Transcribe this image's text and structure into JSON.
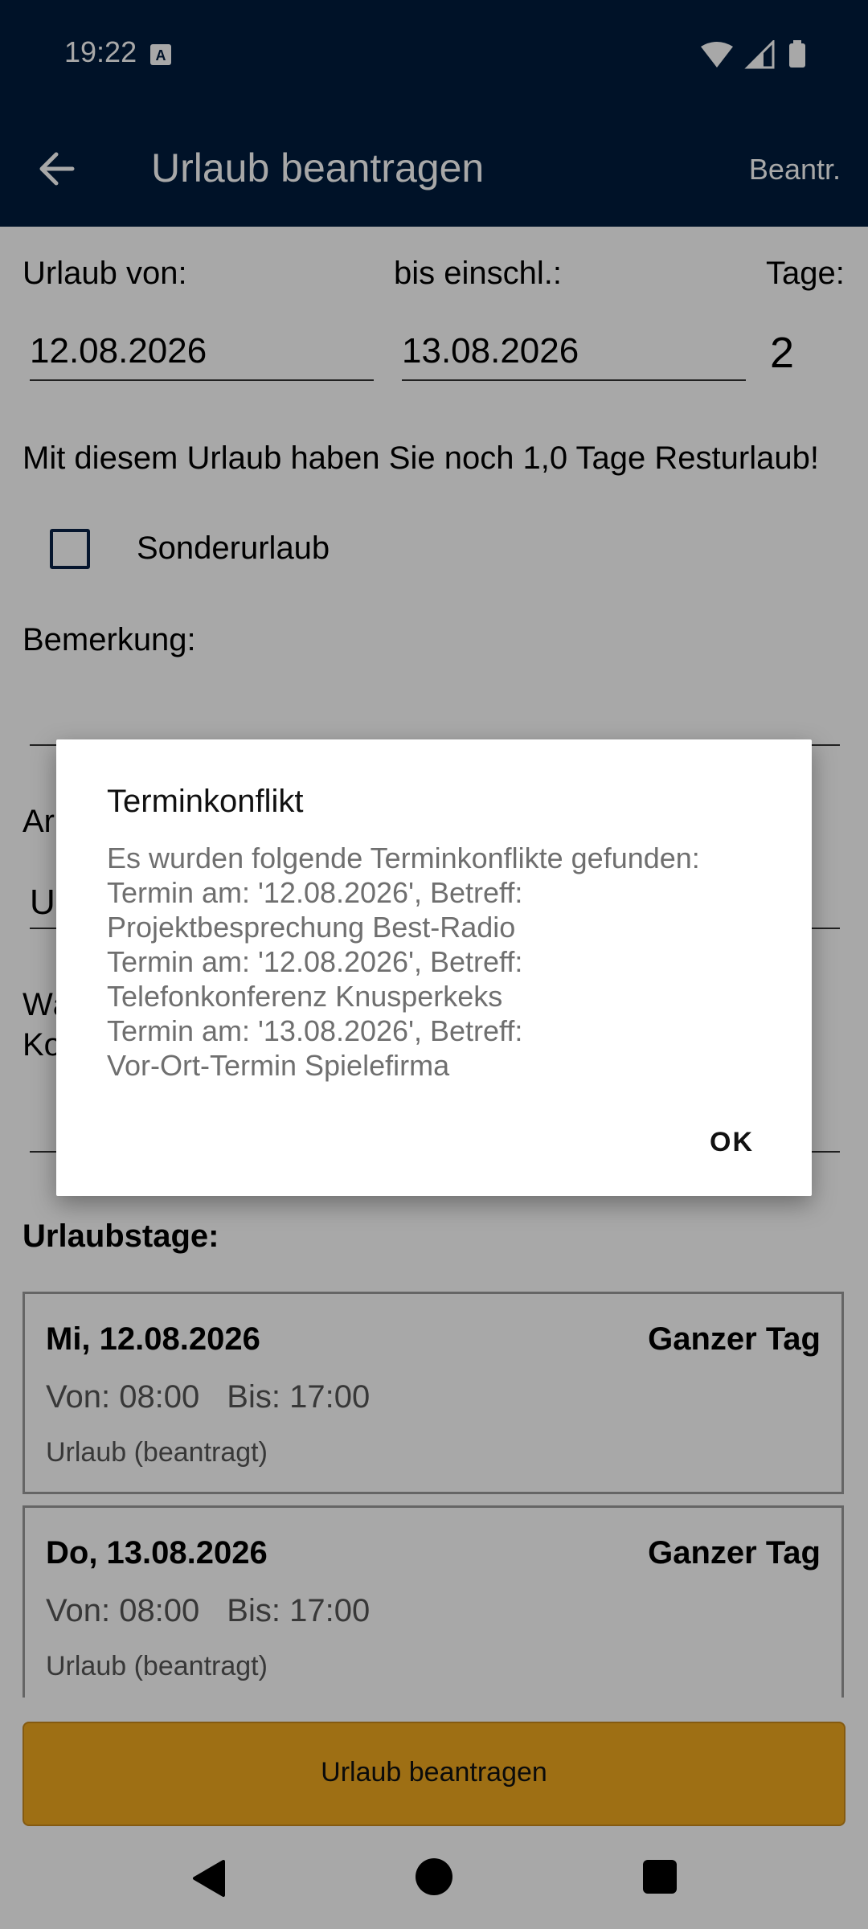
{
  "status_bar": {
    "time": "19:22"
  },
  "app_bar": {
    "title": "Urlaub beantragen",
    "action": "Beantr."
  },
  "form": {
    "from_label": "Urlaub von:",
    "to_label": "bis einschl.:",
    "days_label": "Tage:",
    "from_value": "12.08.2026",
    "to_value": "13.08.2026",
    "days_value": "2",
    "remaining_text": "Mit diesem Urlaub haben Sie noch 1,0 Tage Resturlaub!",
    "special_leave_label": "Sonderurlaub",
    "special_leave_checked": false,
    "remark_label": "Bemerkung:",
    "remark_value": "",
    "partial_label_1": "Ar",
    "partial_value_1": "U",
    "partial_label_2a": "Wä",
    "partial_label_2b": "Ko"
  },
  "days_section": {
    "title": "Urlaubstage:",
    "days": [
      {
        "date": "Mi, 12.08.2026",
        "type": "Ganzer Tag",
        "from": "Von: 08:00",
        "to": "Bis: 17:00",
        "status": "Urlaub (beantragt)"
      },
      {
        "date": "Do, 13.08.2026",
        "type": "Ganzer Tag",
        "from": "Von: 08:00",
        "to": "Bis: 17:00",
        "status": "Urlaub (beantragt)"
      }
    ]
  },
  "submit_button": {
    "label": "Urlaub beantragen"
  },
  "dialog": {
    "title": "Terminkonflikt",
    "message": "Es wurden folgende Terminkonflikte gefunden:\nTermin am: '12.08.2026', Betreff:\nProjektbesprechung Best-Radio\nTermin am: '12.08.2026', Betreff:\nTelefonkonferenz Knusperkeks\nTermin am: '13.08.2026', Betreff:\nVor-Ort-Termin Spielefirma",
    "ok_label": "OK"
  },
  "colors": {
    "app_bar": "#001c3d",
    "primary_button": "#f0a91f",
    "checkbox_border": "#0a2246"
  },
  "icons": {
    "back": "arrow-left-icon",
    "wifi": "wifi-icon",
    "signal": "signal-icon",
    "battery": "battery-icon",
    "nav_back": "nav-back-icon",
    "nav_home": "nav-home-icon",
    "nav_recents": "nav-recents-icon"
  }
}
